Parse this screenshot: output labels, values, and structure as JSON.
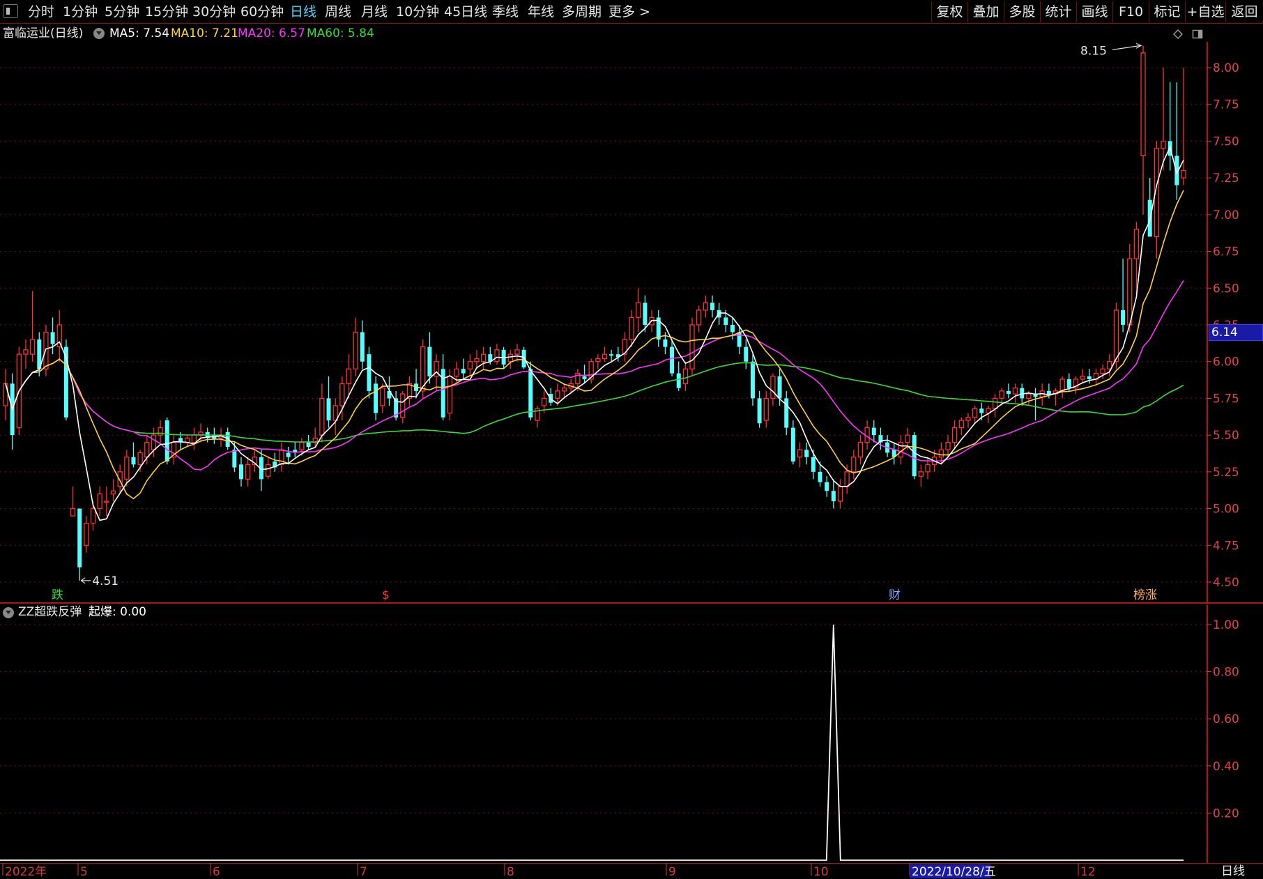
{
  "toolbar": {
    "menu": [
      "分时",
      "1分钟",
      "5分钟",
      "15分钟",
      "30分钟",
      "60分钟",
      "日线",
      "周线",
      "月线",
      "10分钟",
      "45日线",
      "季线",
      "年线",
      "多周期",
      "更多 >"
    ],
    "active": "日线",
    "right": [
      "复权",
      "叠加",
      "多股",
      "统计",
      "画线",
      "F10",
      "标记",
      "+自选",
      "返回"
    ]
  },
  "info": {
    "title": "富临运业(日线)",
    "ma": [
      {
        "label": "MA5: 7.54",
        "color": "#ffffff"
      },
      {
        "label": "MA10: 7.21",
        "color": "#ffd23a"
      },
      {
        "label": "MA20: 6.57",
        "color": "#ff33ff"
      },
      {
        "label": "MA60: 5.84",
        "color": "#33dd33"
      }
    ]
  },
  "sub_info": {
    "name": "ZZ超跌反弹",
    "value_label": "起爆: 0.00"
  },
  "price_tag": "6.14",
  "high_label": "8.15",
  "low_label": "4.51",
  "bottom_right": "日线",
  "markers": [
    {
      "text": "跌",
      "color": "#33dd33"
    },
    {
      "text": "$",
      "color": "#ff3333"
    },
    {
      "text": "财",
      "color": "#7fa8ff"
    },
    {
      "text": "榜涨",
      "color": "#ffb060"
    }
  ],
  "colors": {
    "up": "#ff3030",
    "down": "#54ffff",
    "grid": "#7a1010",
    "axis": "#e04545",
    "ma5": "#ffffff",
    "ma10": "#ffd23a",
    "ma20": "#ff33ff",
    "ma60": "#33dd33",
    "signal": "#ffffff",
    "tag_bg": "#1a1aa8"
  },
  "chart_data": [
    {
      "type": "candlestick",
      "title": "富临运业(日线)",
      "y_ticks": [
        "8.00",
        "7.75",
        "7.50",
        "7.25",
        "7.00",
        "6.75",
        "6.50",
        "6.25",
        "6.00",
        "5.75",
        "5.50",
        "5.25",
        "5.00",
        "4.75",
        "4.50"
      ],
      "ylim": [
        4.4,
        8.3
      ],
      "grid": true,
      "candles": [
        [
          5.7,
          5.95,
          5.6,
          5.85
        ],
        [
          5.85,
          5.92,
          5.4,
          5.5
        ],
        [
          5.55,
          6.1,
          5.5,
          6.05
        ],
        [
          6.05,
          6.15,
          5.95,
          6.08
        ],
        [
          6.05,
          6.48,
          6.0,
          6.15
        ],
        [
          6.15,
          6.2,
          5.9,
          5.95
        ],
        [
          5.95,
          6.25,
          5.9,
          6.2
        ],
        [
          6.2,
          6.3,
          6.05,
          6.12
        ],
        [
          6.1,
          6.35,
          6.0,
          6.25
        ],
        [
          6.1,
          6.15,
          5.6,
          5.62
        ],
        [
          4.95,
          5.15,
          4.95,
          5.0
        ],
        [
          5.0,
          5.0,
          4.51,
          4.6
        ],
        [
          4.75,
          4.95,
          4.7,
          4.9
        ],
        [
          4.9,
          5.05,
          4.85,
          5.0
        ],
        [
          5.0,
          5.15,
          4.95,
          5.1
        ],
        [
          5.05,
          5.15,
          4.95,
          5.05
        ],
        [
          5.1,
          5.2,
          5.05,
          5.12
        ],
        [
          5.15,
          5.3,
          5.1,
          5.25
        ],
        [
          5.2,
          5.4,
          5.15,
          5.35
        ],
        [
          5.35,
          5.45,
          5.28,
          5.3
        ],
        [
          5.3,
          5.4,
          5.25,
          5.38
        ],
        [
          5.35,
          5.5,
          5.3,
          5.45
        ],
        [
          5.4,
          5.55,
          5.35,
          5.5
        ],
        [
          5.5,
          5.6,
          5.45,
          5.55
        ],
        [
          5.6,
          5.62,
          5.3,
          5.32
        ],
        [
          5.35,
          5.5,
          5.3,
          5.45
        ],
        [
          5.48,
          5.52,
          5.4,
          5.45
        ],
        [
          5.45,
          5.5,
          5.42,
          5.48
        ],
        [
          5.45,
          5.55,
          5.4,
          5.5
        ],
        [
          5.5,
          5.58,
          5.45,
          5.52
        ],
        [
          5.52,
          5.55,
          5.45,
          5.48
        ],
        [
          5.5,
          5.55,
          5.44,
          5.47
        ],
        [
          5.48,
          5.55,
          5.42,
          5.5
        ],
        [
          5.52,
          5.55,
          5.4,
          5.42
        ],
        [
          5.4,
          5.45,
          5.25,
          5.28
        ],
        [
          5.3,
          5.35,
          5.15,
          5.2
        ],
        [
          5.2,
          5.35,
          5.15,
          5.3
        ],
        [
          5.3,
          5.4,
          5.25,
          5.35
        ],
        [
          5.35,
          5.4,
          5.12,
          5.2
        ],
        [
          5.22,
          5.35,
          5.2,
          5.3
        ],
        [
          5.32,
          5.38,
          5.25,
          5.28
        ],
        [
          5.3,
          5.45,
          5.25,
          5.4
        ],
        [
          5.38,
          5.42,
          5.3,
          5.35
        ],
        [
          5.4,
          5.45,
          5.35,
          5.38
        ],
        [
          5.4,
          5.48,
          5.36,
          5.45
        ],
        [
          5.45,
          5.5,
          5.4,
          5.42
        ],
        [
          5.45,
          5.55,
          5.42,
          5.48
        ],
        [
          5.5,
          5.85,
          5.45,
          5.75
        ],
        [
          5.75,
          5.9,
          5.55,
          5.6
        ],
        [
          5.6,
          5.75,
          5.5,
          5.7
        ],
        [
          5.7,
          5.9,
          5.6,
          5.85
        ],
        [
          5.85,
          6.05,
          5.75,
          5.95
        ],
        [
          5.95,
          6.3,
          5.9,
          6.2
        ],
        [
          6.2,
          6.28,
          5.95,
          6.0
        ],
        [
          6.05,
          6.1,
          5.75,
          5.8
        ],
        [
          5.85,
          5.9,
          5.6,
          5.65
        ],
        [
          5.7,
          5.85,
          5.65,
          5.82
        ],
        [
          5.8,
          5.9,
          5.7,
          5.75
        ],
        [
          5.75,
          5.8,
          5.6,
          5.62
        ],
        [
          5.62,
          5.8,
          5.58,
          5.78
        ],
        [
          5.75,
          5.9,
          5.7,
          5.85
        ],
        [
          5.85,
          5.95,
          5.75,
          5.8
        ],
        [
          5.8,
          6.15,
          5.75,
          6.1
        ],
        [
          6.1,
          6.2,
          5.85,
          5.9
        ],
        [
          5.9,
          6.05,
          5.8,
          6.0
        ],
        [
          5.95,
          6.05,
          5.6,
          5.62
        ],
        [
          5.65,
          5.95,
          5.6,
          5.9
        ],
        [
          5.9,
          6.0,
          5.85,
          5.95
        ],
        [
          5.95,
          6.02,
          5.88,
          5.92
        ],
        [
          5.95,
          6.05,
          5.9,
          6.0
        ],
        [
          6.0,
          6.08,
          5.95,
          6.02
        ],
        [
          6.0,
          6.1,
          5.95,
          6.05
        ],
        [
          6.05,
          6.1,
          5.98,
          6.0
        ],
        [
          6.0,
          6.12,
          5.98,
          6.08
        ],
        [
          6.08,
          6.1,
          5.95,
          5.98
        ],
        [
          6.0,
          6.08,
          5.95,
          6.05
        ],
        [
          6.05,
          6.12,
          6.0,
          6.08
        ],
        [
          6.08,
          6.1,
          5.95,
          5.96
        ],
        [
          5.95,
          6.0,
          5.6,
          5.62
        ],
        [
          5.6,
          5.7,
          5.55,
          5.68
        ],
        [
          5.7,
          5.8,
          5.65,
          5.75
        ],
        [
          5.78,
          5.82,
          5.7,
          5.72
        ],
        [
          5.75,
          5.85,
          5.7,
          5.8
        ],
        [
          5.8,
          5.85,
          5.75,
          5.82
        ],
        [
          5.82,
          5.88,
          5.78,
          5.85
        ],
        [
          5.85,
          5.95,
          5.8,
          5.92
        ],
        [
          5.9,
          5.98,
          5.85,
          5.88
        ],
        [
          5.88,
          6.02,
          5.85,
          6.0
        ],
        [
          6.0,
          6.05,
          5.95,
          6.02
        ],
        [
          6.02,
          6.1,
          6.0,
          6.05
        ],
        [
          6.05,
          6.08,
          6.0,
          6.04
        ],
        [
          6.05,
          6.1,
          6.0,
          6.03
        ],
        [
          6.05,
          6.2,
          6.0,
          6.15
        ],
        [
          6.15,
          6.35,
          6.1,
          6.3
        ],
        [
          6.3,
          6.5,
          6.2,
          6.4
        ],
        [
          6.4,
          6.45,
          6.2,
          6.25
        ],
        [
          6.25,
          6.35,
          6.2,
          6.3
        ],
        [
          6.3,
          6.35,
          6.1,
          6.15
        ],
        [
          6.15,
          6.2,
          6.05,
          6.1
        ],
        [
          6.1,
          6.15,
          5.9,
          5.92
        ],
        [
          5.92,
          6.0,
          5.8,
          5.82
        ],
        [
          5.85,
          6.0,
          5.8,
          5.95
        ],
        [
          5.95,
          6.3,
          5.9,
          6.25
        ],
        [
          6.25,
          6.38,
          6.2,
          6.35
        ],
        [
          6.35,
          6.45,
          6.3,
          6.4
        ],
        [
          6.4,
          6.45,
          6.3,
          6.35
        ],
        [
          6.35,
          6.4,
          6.25,
          6.3
        ],
        [
          6.3,
          6.35,
          6.2,
          6.25
        ],
        [
          6.25,
          6.3,
          6.15,
          6.2
        ],
        [
          6.2,
          6.25,
          6.05,
          6.1
        ],
        [
          6.1,
          6.15,
          5.95,
          6.0
        ],
        [
          6.0,
          6.05,
          5.7,
          5.75
        ],
        [
          5.75,
          5.8,
          5.55,
          5.58
        ],
        [
          5.6,
          5.8,
          5.55,
          5.75
        ],
        [
          5.75,
          5.92,
          5.7,
          5.9
        ],
        [
          5.9,
          5.95,
          5.7,
          5.75
        ],
        [
          5.75,
          5.8,
          5.5,
          5.55
        ],
        [
          5.55,
          5.6,
          5.3,
          5.32
        ],
        [
          5.35,
          5.45,
          5.28,
          5.4
        ],
        [
          5.4,
          5.45,
          5.3,
          5.35
        ],
        [
          5.35,
          5.4,
          5.2,
          5.25
        ],
        [
          5.25,
          5.32,
          5.15,
          5.18
        ],
        [
          5.18,
          5.22,
          5.08,
          5.12
        ],
        [
          5.12,
          5.2,
          5.0,
          5.05
        ],
        [
          5.05,
          5.2,
          5.0,
          5.15
        ],
        [
          5.15,
          5.3,
          5.1,
          5.25
        ],
        [
          5.25,
          5.4,
          5.2,
          5.35
        ],
        [
          5.35,
          5.5,
          5.3,
          5.45
        ],
        [
          5.45,
          5.6,
          5.4,
          5.55
        ],
        [
          5.55,
          5.6,
          5.45,
          5.5
        ],
        [
          5.5,
          5.55,
          5.4,
          5.45
        ],
        [
          5.45,
          5.5,
          5.35,
          5.38
        ],
        [
          5.4,
          5.45,
          5.3,
          5.35
        ],
        [
          5.35,
          5.5,
          5.3,
          5.45
        ],
        [
          5.45,
          5.55,
          5.4,
          5.5
        ],
        [
          5.5,
          5.52,
          5.2,
          5.22
        ],
        [
          5.22,
          5.3,
          5.15,
          5.25
        ],
        [
          5.25,
          5.35,
          5.2,
          5.3
        ],
        [
          5.3,
          5.4,
          5.25,
          5.35
        ],
        [
          5.35,
          5.45,
          5.3,
          5.4
        ],
        [
          5.4,
          5.5,
          5.35,
          5.45
        ],
        [
          5.45,
          5.6,
          5.4,
          5.55
        ],
        [
          5.55,
          5.62,
          5.5,
          5.6
        ],
        [
          5.6,
          5.65,
          5.55,
          5.62
        ],
        [
          5.62,
          5.7,
          5.58,
          5.68
        ],
        [
          5.68,
          5.72,
          5.6,
          5.65
        ],
        [
          5.65,
          5.7,
          5.58,
          5.68
        ],
        [
          5.68,
          5.78,
          5.62,
          5.75
        ],
        [
          5.75,
          5.82,
          5.7,
          5.8
        ],
        [
          5.8,
          5.85,
          5.75,
          5.78
        ],
        [
          5.78,
          5.85,
          5.72,
          5.82
        ],
        [
          5.82,
          5.85,
          5.7,
          5.75
        ],
        [
          5.75,
          5.8,
          5.7,
          5.78
        ],
        [
          5.78,
          5.82,
          5.6,
          5.76
        ],
        [
          5.76,
          5.85,
          5.7,
          5.8
        ],
        [
          5.8,
          5.85,
          5.75,
          5.78
        ],
        [
          5.78,
          5.82,
          5.7,
          5.8
        ],
        [
          5.8,
          5.9,
          5.75,
          5.88
        ],
        [
          5.88,
          5.92,
          5.8,
          5.82
        ],
        [
          5.82,
          5.9,
          5.78,
          5.88
        ],
        [
          5.88,
          5.95,
          5.85,
          5.9
        ],
        [
          5.9,
          5.95,
          5.85,
          5.88
        ],
        [
          5.88,
          5.95,
          5.84,
          5.92
        ],
        [
          5.92,
          5.98,
          5.88,
          5.95
        ],
        [
          5.95,
          6.05,
          5.9,
          6.0
        ],
        [
          6.0,
          6.4,
          5.95,
          6.35
        ],
        [
          6.35,
          6.7,
          6.2,
          6.25
        ],
        [
          6.25,
          6.8,
          6.2,
          6.7
        ],
        [
          6.7,
          6.95,
          6.45,
          6.9
        ],
        [
          7.4,
          8.15,
          7.0,
          8.1
        ],
        [
          7.1,
          7.25,
          6.85,
          6.85
        ],
        [
          6.85,
          7.5,
          6.7,
          7.45
        ],
        [
          7.45,
          8.0,
          7.3,
          7.5
        ],
        [
          7.5,
          7.9,
          7.3,
          7.4
        ],
        [
          7.4,
          7.9,
          7.1,
          7.2
        ],
        [
          7.25,
          8.0,
          7.2,
          7.3
        ]
      ]
    },
    {
      "type": "line",
      "title": "ZZ超跌反弹",
      "series": [
        {
          "name": "起爆",
          "peak_value": 1.0
        }
      ],
      "y_ticks": [
        "1.00",
        "0.80",
        "0.60",
        "0.40",
        "0.20"
      ],
      "ylim": [
        0,
        1.05
      ]
    }
  ],
  "date_axis": [
    "2022年",
    "5",
    "6",
    "7",
    "8",
    "9",
    "10",
    "2022/10/28/五",
    "12"
  ]
}
